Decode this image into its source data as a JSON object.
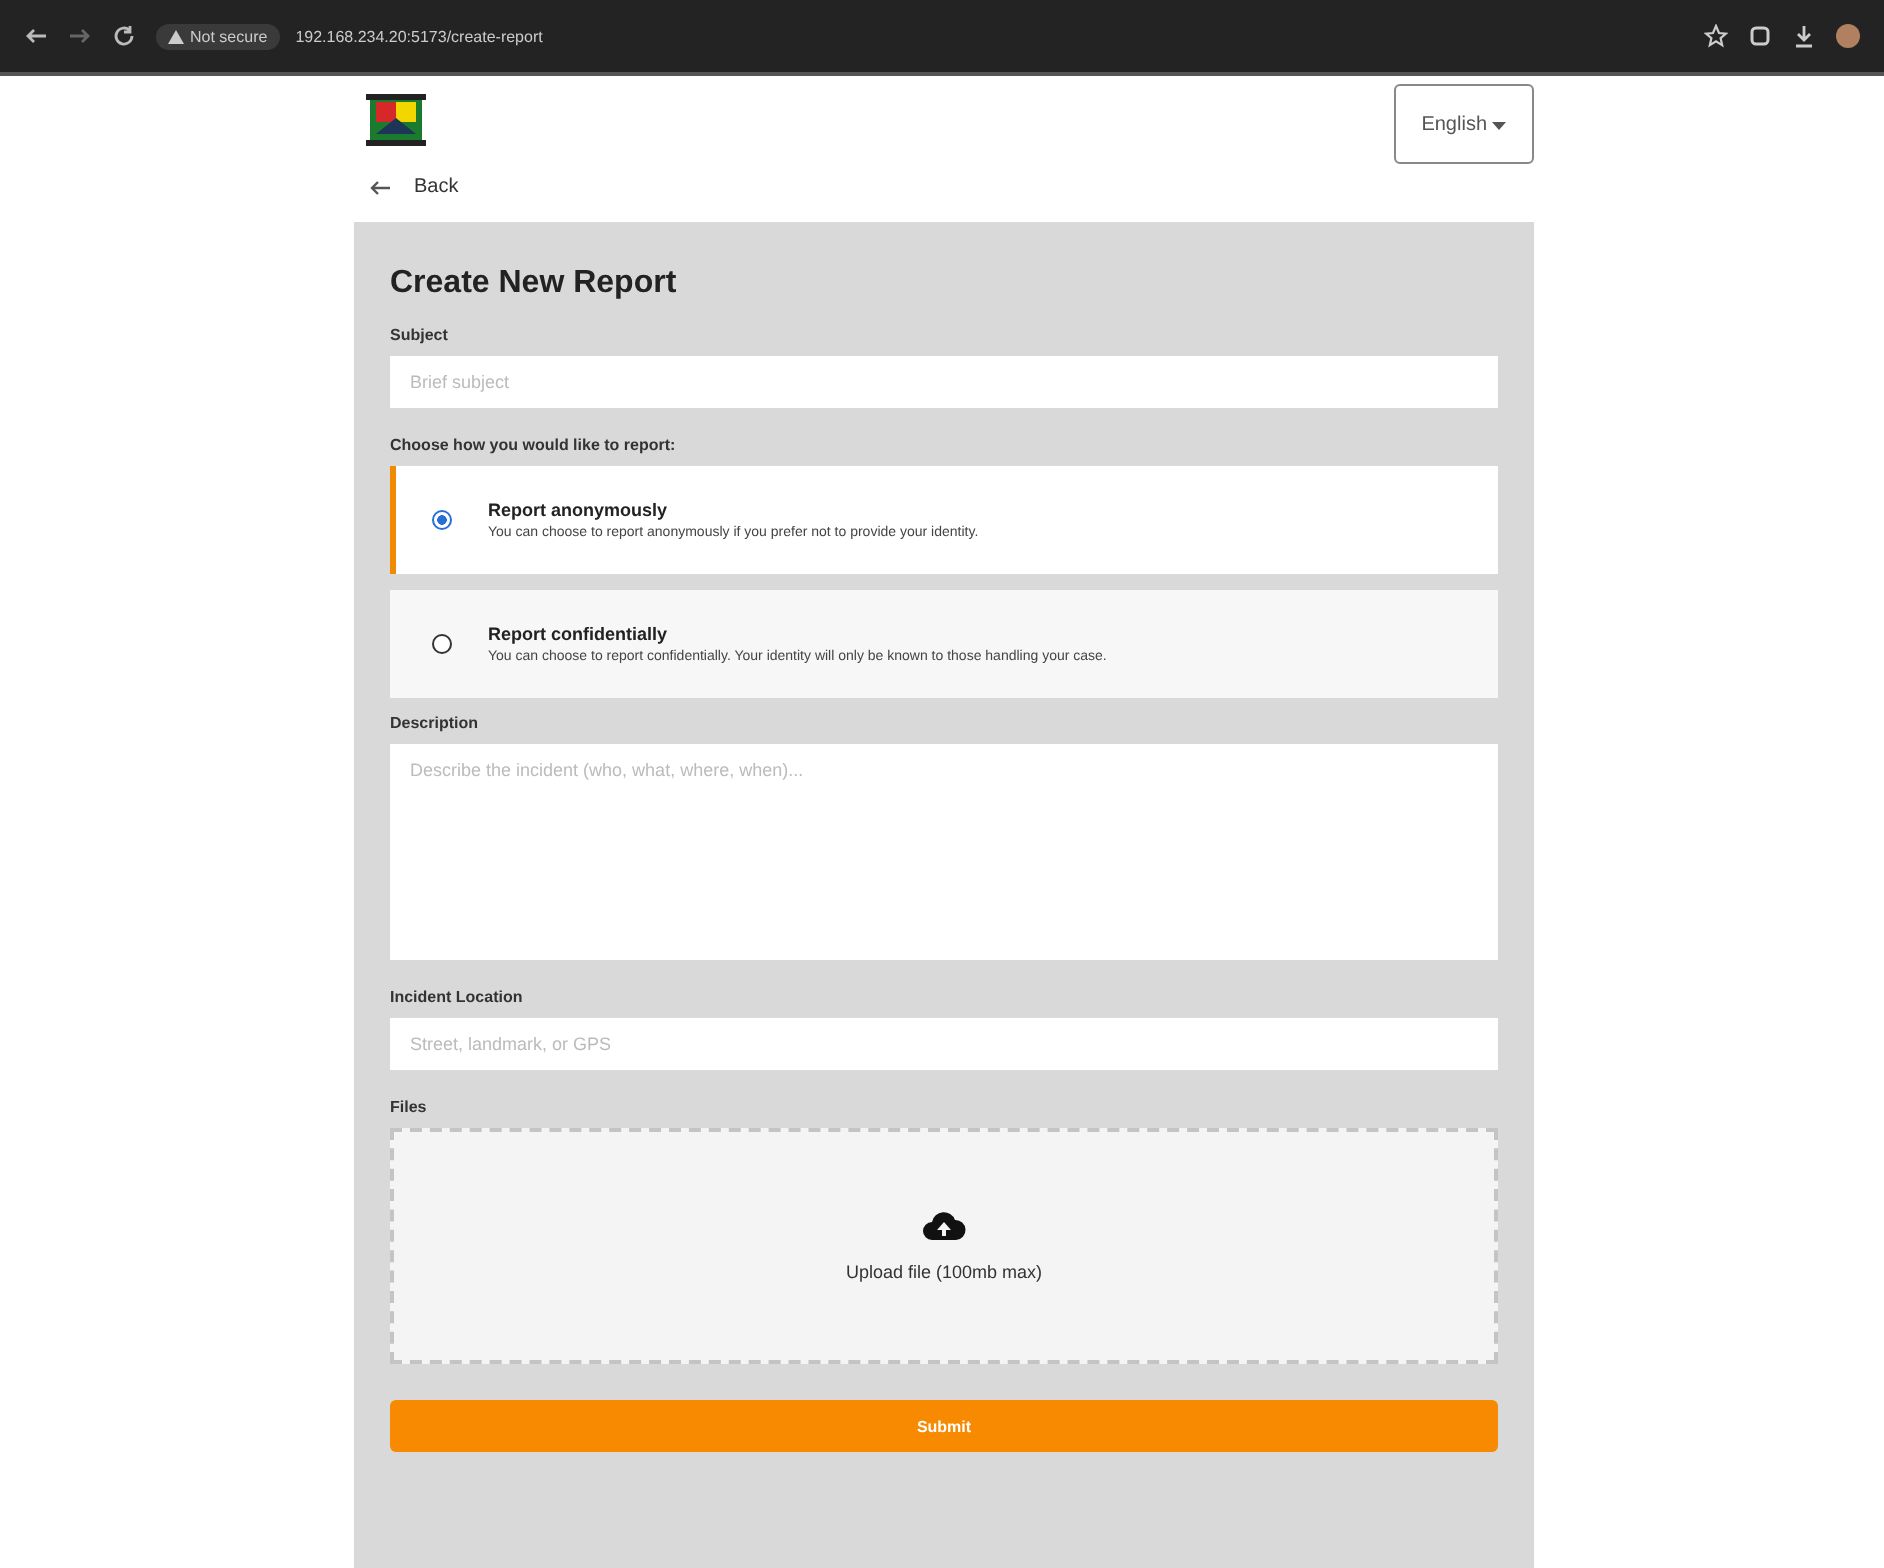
{
  "browser": {
    "security": "Not secure",
    "url": "192.168.234.20:5173/create-report"
  },
  "language": {
    "value": "English"
  },
  "back": {
    "label": "Back"
  },
  "form": {
    "title": "Create New Report",
    "subject": {
      "label": "Subject",
      "placeholder": "Brief subject"
    },
    "mode_label": "Choose how you would like to report:",
    "modes": [
      {
        "title": "Report anonymously",
        "description": "You can choose to report anonymously if you prefer not to provide your identity.",
        "selected": true
      },
      {
        "title": "Report confidentially",
        "description": "You can choose to report confidentially. Your identity will only be known to those handling your case.",
        "selected": false
      }
    ],
    "description": {
      "label": "Description",
      "placeholder": "Describe the incident (who, what, where, when)..."
    },
    "location": {
      "label": "Incident Location",
      "placeholder": "Street, landmark, or GPS"
    },
    "files": {
      "label": "Files",
      "hint": "Upload file (100mb max)"
    },
    "submit": "Submit"
  }
}
